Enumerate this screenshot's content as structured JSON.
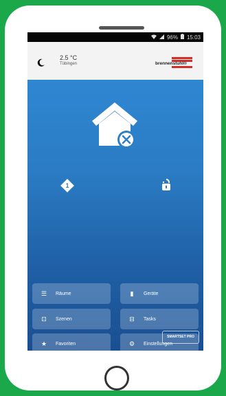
{
  "status_bar": {
    "signal": "96%",
    "time": "15:03"
  },
  "header": {
    "weather_icon": "moon-icon",
    "temperature": "2.5 °C",
    "city": "Tübingen",
    "brand": "brennenstuhl®"
  },
  "main": {
    "status_icon": "house-disarmed-icon",
    "warning_count": "1",
    "lock_icon": "lock-open-icon"
  },
  "menu": [
    {
      "label": "Räume",
      "icon": "list-icon"
    },
    {
      "label": "Geräte",
      "icon": "device-icon"
    },
    {
      "label": "Szenen",
      "icon": "scene-icon"
    },
    {
      "label": "Tasks",
      "icon": "tasks-icon"
    },
    {
      "label": "Favoriten",
      "icon": "star-icon"
    },
    {
      "label": "Einstellungen",
      "icon": "settings-icon"
    }
  ],
  "footer": {
    "badge": "SMARTSET PRO"
  },
  "colors": {
    "accent": "#2d7fc8",
    "brand_red": "#d32d27",
    "frame": "#1aa84a"
  }
}
